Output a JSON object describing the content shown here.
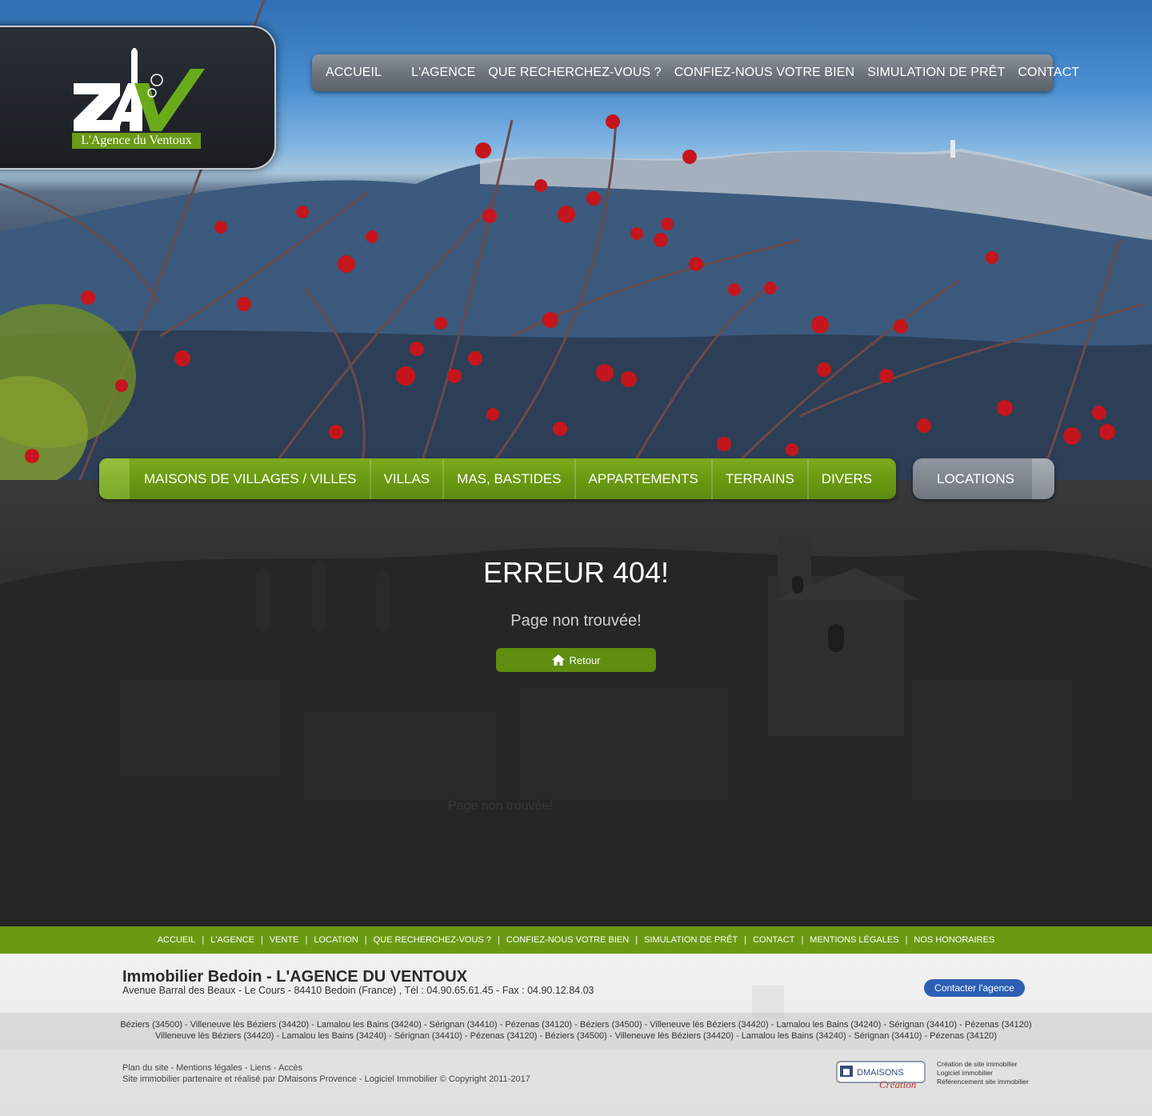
{
  "logo": {
    "letters": "ZAV",
    "caption": "L'Agence du Ventoux"
  },
  "topnav": {
    "items": [
      "ACCUEIL",
      "L'AGENCE",
      "QUE RECHERCHEZ-VOUS ?",
      "CONFIEZ-NOUS VOTRE BIEN",
      "SIMULATION DE PRÊT",
      "CONTACT"
    ]
  },
  "categories": {
    "items": [
      "MAISONS DE VILLAGES / VILLES",
      "VILLAS",
      "MAS, BASTIDES",
      "APPARTEMENTS",
      "TERRAINS",
      "DIVERS"
    ],
    "locations": "LOCATIONS"
  },
  "error": {
    "title": "ERREUR 404!",
    "subtitle": "Page non trouvée!",
    "back_label": "Retour",
    "ghost": "Page non trouvée!"
  },
  "footnav": {
    "items": [
      "ACCUEIL",
      "L'AGENCE",
      "VENTE",
      "LOCATION",
      "QUE RECHERCHEZ-VOUS ?",
      "CONFIEZ-NOUS VOTRE BIEN",
      "SIMULATION DE PRÊT",
      "CONTACT",
      "MENTIONS LÉGALES",
      "NOS HONORAIRES"
    ]
  },
  "footer": {
    "title": "Immobilier Bedoin - L'AGENCE DU VENTOUX",
    "address": "Avenue Barral des Beaux - Le Cours - 84410 Bedoin (France) , Tél : 04.90.65.61.45 - Fax : 04.90.12.84.03",
    "contact_button": "Contacter l'agence",
    "cities_line1": "Béziers (34500) - Villeneuve lès Béziers (34420) - Lamalou les Bains (34240) - Sérignan (34410) - Pézenas (34120) - Béziers (34500) - Villeneuve lès Béziers (34420) - Lamalou les Bains (34240) - Sérignan (34410) - Pézenas (34120)",
    "cities_line2": "Villeneuve lès Béziers (34420) - Lamalou les Bains (34240) - Sérignan (34410) - Pézenas (34120) - Béziers (34500) - Villeneuve lès Béziers (34420) - Lamalou les Bains (34240) - Sérignan (34410) - Pézenas (34120)",
    "links": "Plan du site - Mentions légales - Liens - Accès",
    "credit": "Site immobilier partenaire et réalisé par DMaisons Provence - Logiciel Immobilier © Copyright 2011-2017",
    "dm_brand": "DMAISONS",
    "dm_script": "Création",
    "dm_lines": [
      "Création de site immobilier",
      "Logiciel immobilier",
      "Référencement site immobilier"
    ]
  },
  "colors": {
    "green": "#6a9a12",
    "nav_gray": "#70777f",
    "contact_blue": "#2c5fb4"
  }
}
